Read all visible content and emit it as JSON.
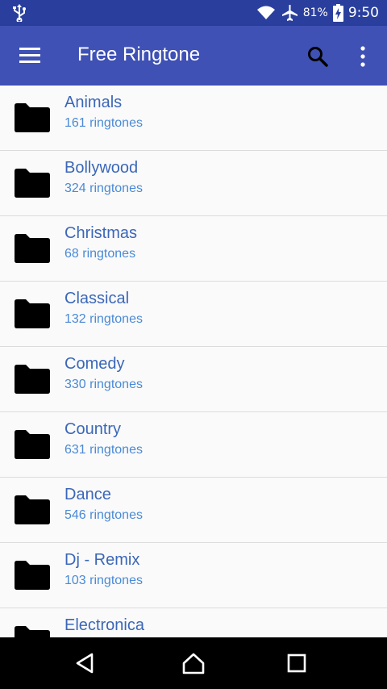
{
  "status": {
    "battery_percent": "81%",
    "time": "9:50",
    "icons": [
      "usb-icon",
      "wifi-icon",
      "airplane-icon",
      "battery-charging-icon"
    ]
  },
  "appbar": {
    "title": "Free Ringtone",
    "icons": [
      "menu-icon",
      "search-icon",
      "more-vert-icon"
    ],
    "color": "#3f51b5",
    "status_color": "#2a3f9d"
  },
  "categories": [
    {
      "name": "Animals",
      "count": "161 ringtones"
    },
    {
      "name": "Bollywood",
      "count": "324 ringtones"
    },
    {
      "name": "Christmas",
      "count": "68 ringtones"
    },
    {
      "name": "Classical",
      "count": "132 ringtones"
    },
    {
      "name": "Comedy",
      "count": "330 ringtones"
    },
    {
      "name": "Country",
      "count": "631 ringtones"
    },
    {
      "name": "Dance",
      "count": "546 ringtones"
    },
    {
      "name": "Dj - Remix",
      "count": "103 ringtones"
    },
    {
      "name": "Electronica",
      "count": ""
    }
  ],
  "navbar": {
    "icons": [
      "back-icon",
      "home-icon",
      "recents-icon"
    ]
  }
}
